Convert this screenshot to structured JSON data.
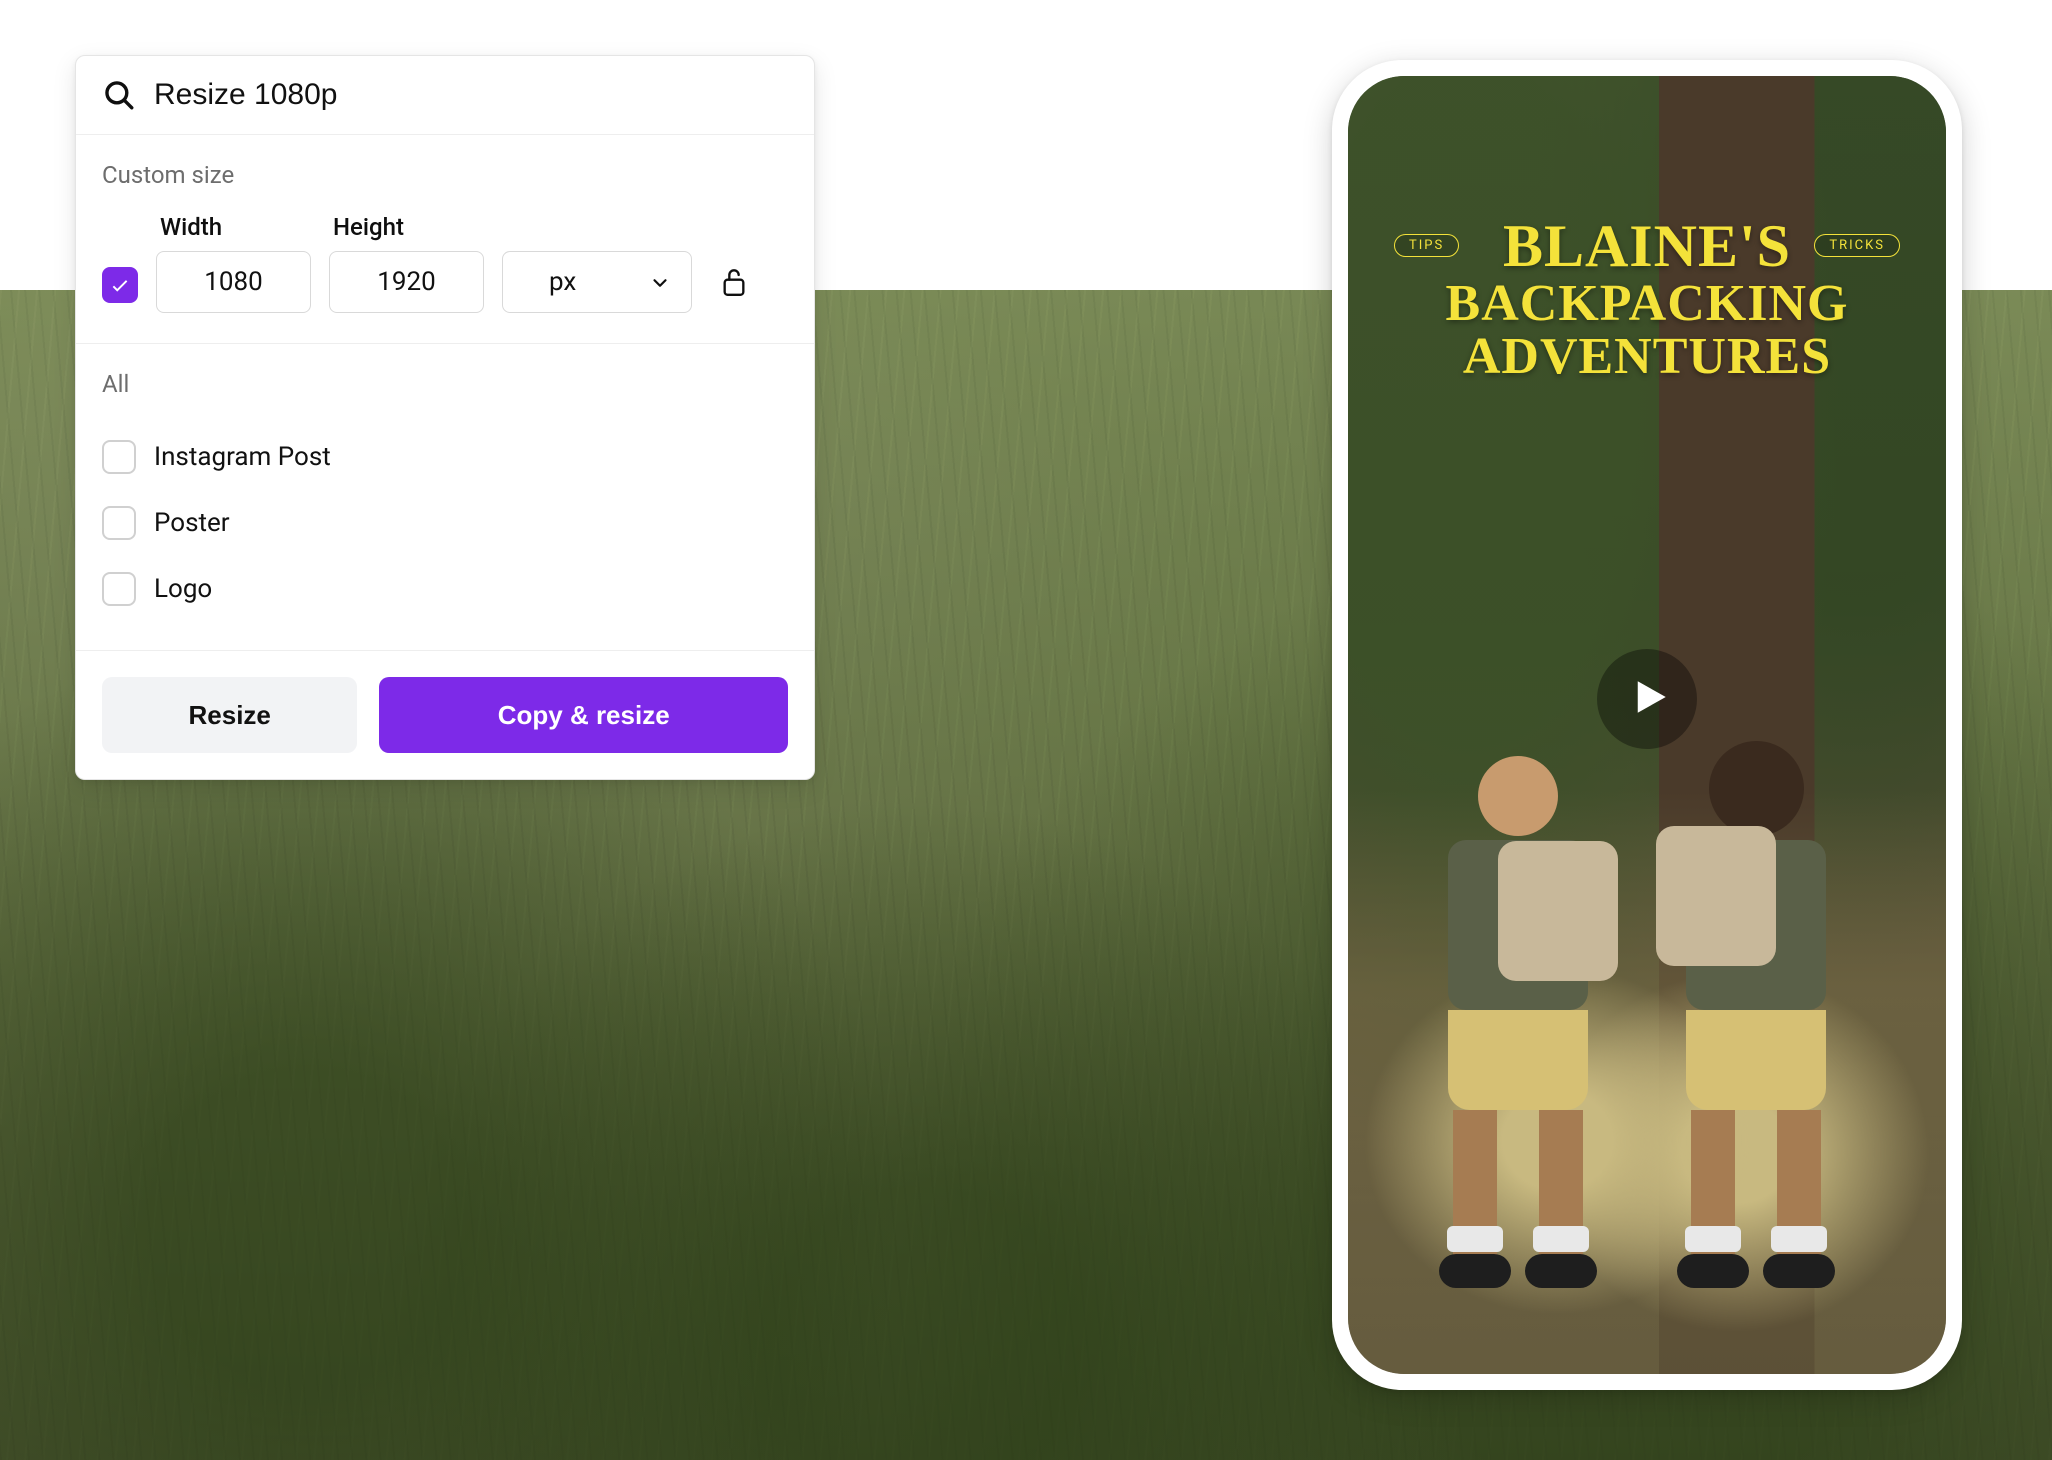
{
  "search": {
    "value": "Resize 1080p",
    "placeholder": "Search"
  },
  "custom_size": {
    "title": "Custom size",
    "checked": true,
    "width_label": "Width",
    "height_label": "Height",
    "width_value": "1080",
    "height_value": "1920",
    "unit_value": "px",
    "lock_locked": false
  },
  "all_section": {
    "title": "All",
    "items": [
      {
        "label": "Instagram Post",
        "checked": false
      },
      {
        "label": "Poster",
        "checked": false
      },
      {
        "label": "Logo",
        "checked": false
      }
    ]
  },
  "actions": {
    "resize_label": "Resize",
    "copy_resize_label": "Copy & resize"
  },
  "preview": {
    "badge_left": "TIPS",
    "badge_right": "TRICKS",
    "title_line1": "BLAINE'S",
    "title_line2": "BACKPACKING",
    "title_line3": "ADVENTURES",
    "play_icon": "play-icon"
  },
  "colors": {
    "accent": "#7d2ae8",
    "poster_text": "#f4e23a"
  }
}
